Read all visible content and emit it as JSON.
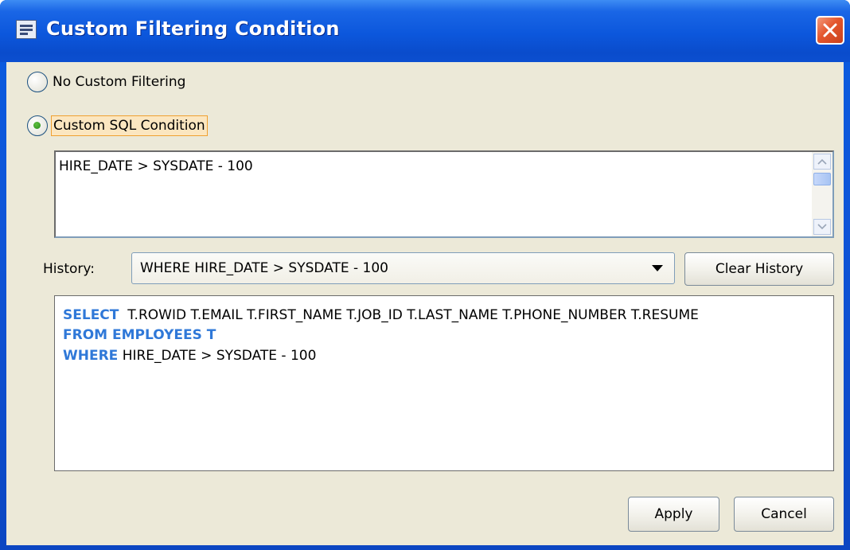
{
  "window": {
    "title": "Custom Filtering Condition",
    "icon": "dialog-app-icon",
    "close_icon": "close-icon"
  },
  "filtering": {
    "option_none": {
      "label": "No Custom Filtering",
      "selected": false
    },
    "option_custom": {
      "label": "Custom SQL Condition",
      "selected": true
    }
  },
  "condition": {
    "value": "HIRE_DATE > SYSDATE - 100"
  },
  "history": {
    "label": "History:",
    "selected": "WHERE HIRE_DATE > SYSDATE - 100",
    "clear_button": "Clear History"
  },
  "sql_preview": {
    "select_keyword": "SELECT",
    "select_columns": "T.ROWID T.EMAIL T.FIRST_NAME T.JOB_ID T.LAST_NAME T.PHONE_NUMBER T.RESUME",
    "from_clause": "FROM EMPLOYEES T",
    "where_keyword": "WHERE",
    "where_condition": "HIRE_DATE > SYSDATE - 100"
  },
  "actions": {
    "apply": "Apply",
    "cancel": "Cancel"
  },
  "colors": {
    "title_bar": "#0c57dc",
    "dialog_bg": "#ece9d8",
    "sql_keyword": "#2f78d8",
    "close_button": "#e4562d"
  }
}
